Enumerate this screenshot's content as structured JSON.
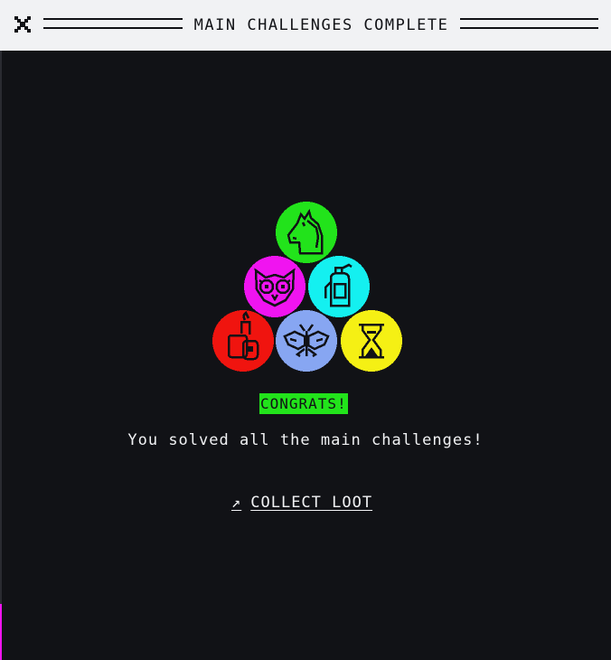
{
  "window": {
    "title": "MAIN CHALLENGES COMPLETE",
    "close_icon": "close-icon",
    "background": "#111216",
    "titlebar_background": "#f1f2f4"
  },
  "badges": [
    {
      "name": "horse",
      "icon": "horse-head-icon",
      "color": "#22e31b"
    },
    {
      "name": "owl",
      "icon": "owl-icon",
      "color": "#f014f0"
    },
    {
      "name": "extinguisher",
      "icon": "fire-extinguisher-icon",
      "color": "#14f0f0"
    },
    {
      "name": "lighter",
      "icon": "lighter-icon",
      "color": "#f0140f"
    },
    {
      "name": "moth",
      "icon": "moth-icon",
      "color": "#87a6f2"
    },
    {
      "name": "hourglass",
      "icon": "hourglass-icon",
      "color": "#f5f014"
    }
  ],
  "congrats": {
    "label": "CONGRATS!",
    "background": "#22e31b"
  },
  "message": "You solved all the main challenges!",
  "collect": {
    "arrow": "↗",
    "label": "COLLECT LOOT",
    "icon": "arrow-up-right-icon"
  },
  "edge_accent_color": "#f014f0"
}
